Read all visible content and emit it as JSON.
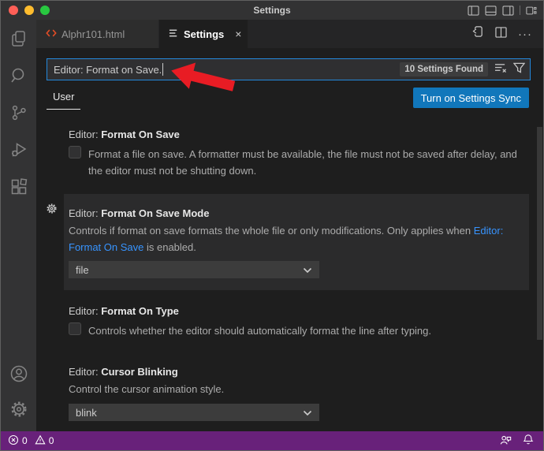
{
  "titlebar": {
    "title": "Settings"
  },
  "tabs": {
    "tab1": {
      "label": "Alphr101.html"
    },
    "tab2": {
      "label": "Settings",
      "close": "×"
    }
  },
  "tab_actions": {
    "more": "···"
  },
  "search": {
    "value": "Editor: Format on Save.",
    "results_badge": "10 Settings Found"
  },
  "header": {
    "scope_tab": "User",
    "sync_button": "Turn on Settings Sync"
  },
  "settings": {
    "format_on_save": {
      "category": "Editor: ",
      "name": "Format On Save",
      "description": "Format a file on save. A formatter must be available, the file must not be saved after delay, and the editor must not be shutting down."
    },
    "format_on_save_mode": {
      "category": "Editor: ",
      "name": "Format On Save Mode",
      "description_before_link": "Controls if format on save formats the whole file or only modifications. Only applies when ",
      "link_text": "Editor: Format On Save",
      "description_after_link": " is enabled.",
      "value": "file"
    },
    "format_on_type": {
      "category": "Editor: ",
      "name": "Format On Type",
      "description": "Controls whether the editor should automatically format the line after typing."
    },
    "cursor_blinking": {
      "category": "Editor: ",
      "name": "Cursor Blinking",
      "description": "Control the cursor animation style.",
      "value": "blink"
    }
  },
  "statusbar": {
    "errors": "0",
    "warnings": "0"
  },
  "colors": {
    "accent_blue": "#1177bb",
    "focus_border": "#2488db",
    "link_blue": "#3794ff",
    "statusbar_purple": "#68217a",
    "arrow_red": "#e81c24",
    "html_icon_orange": "#e44d26"
  }
}
